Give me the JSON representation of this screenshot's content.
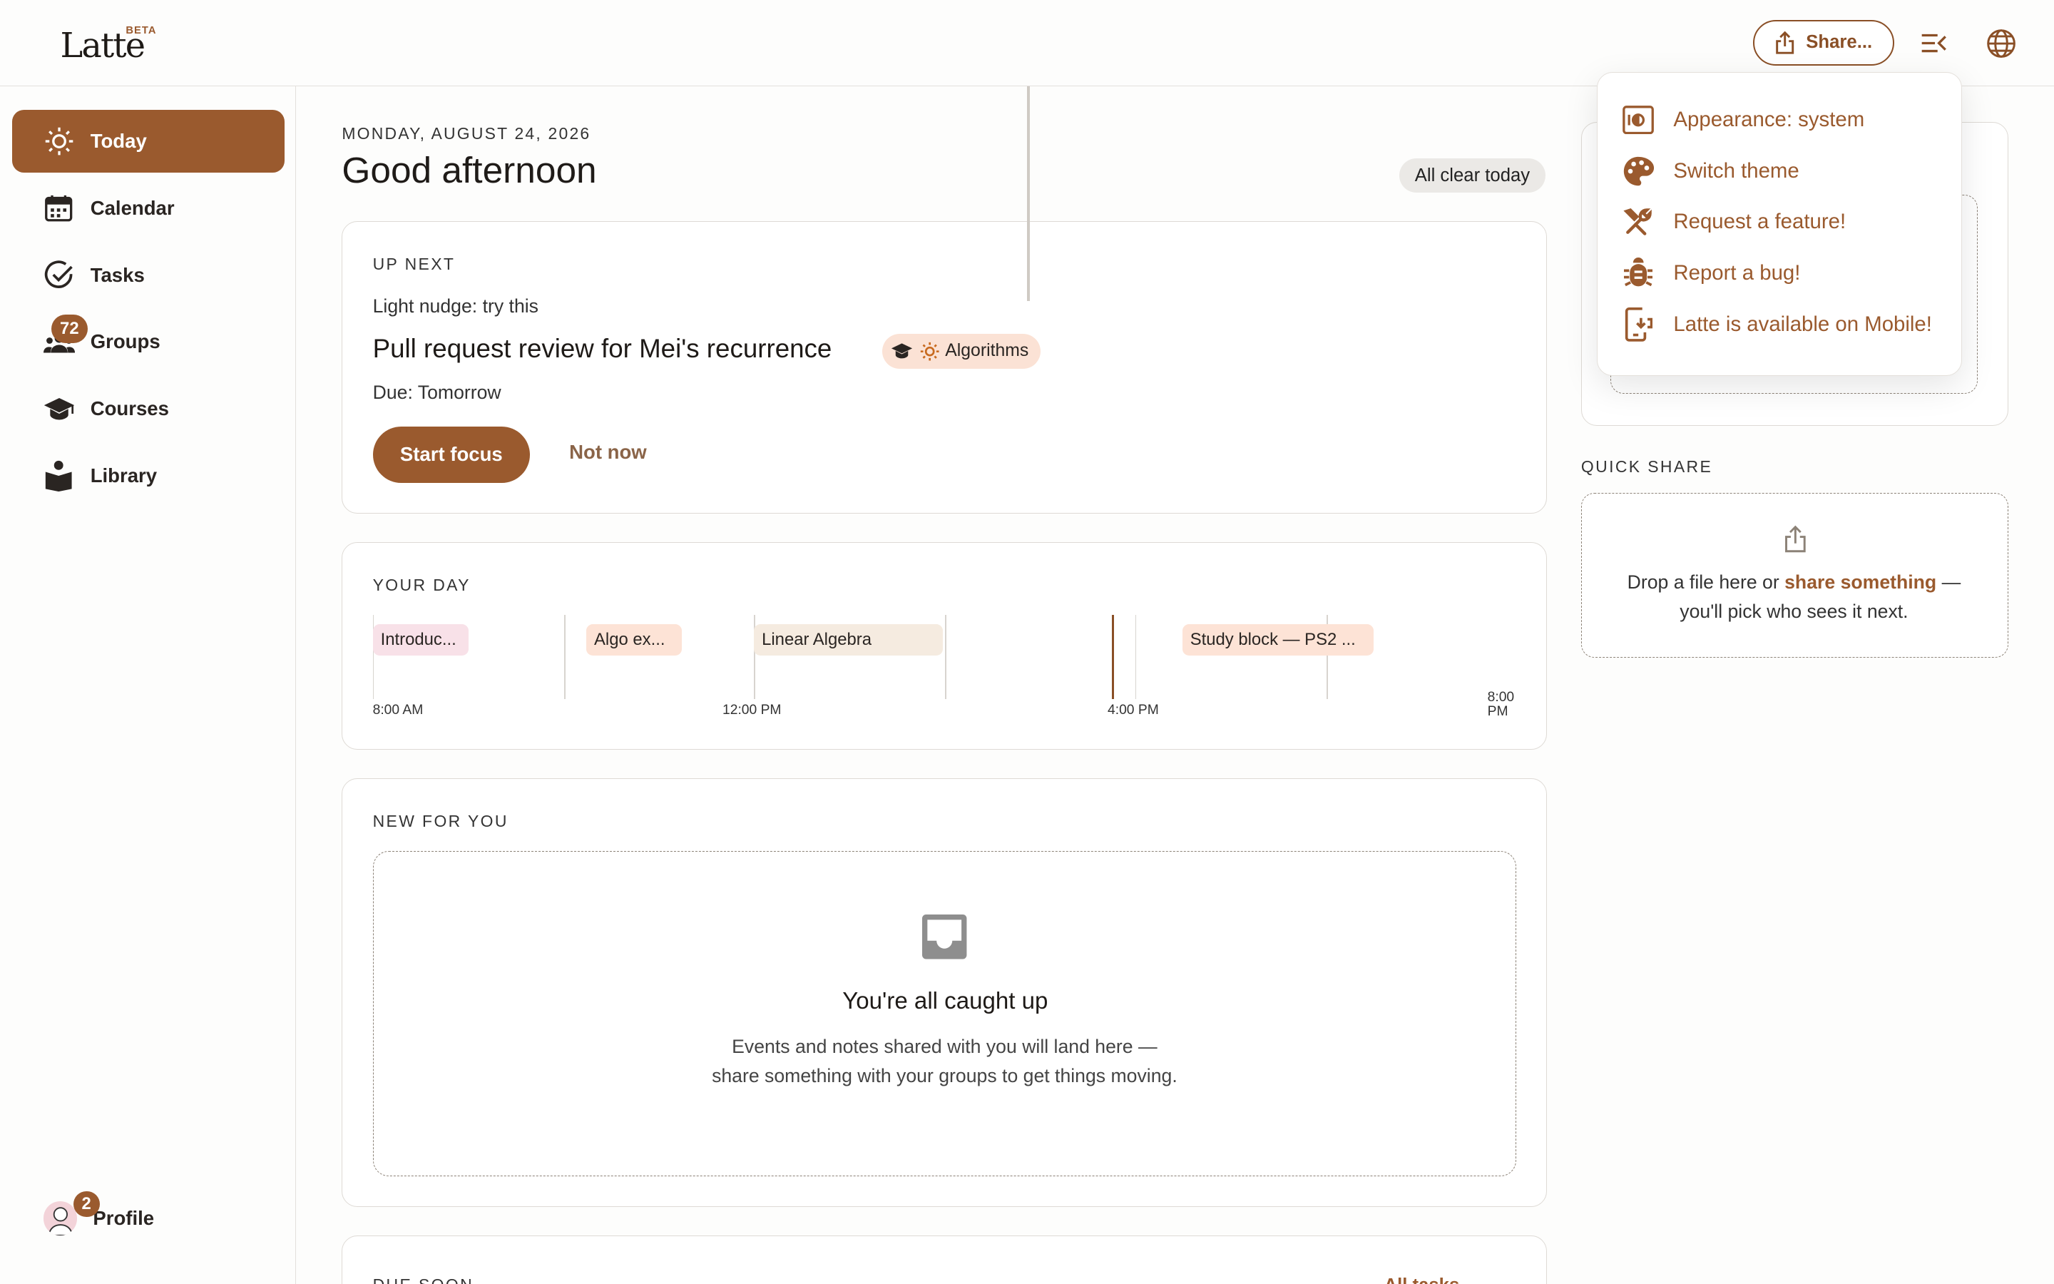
{
  "brand": {
    "name": "Latte",
    "beta": "BETA"
  },
  "topbar": {
    "share_label": "Share..."
  },
  "sidebar": {
    "items": [
      {
        "label": "Today",
        "icon": "sun-icon"
      },
      {
        "label": "Calendar",
        "icon": "calendar-icon"
      },
      {
        "label": "Tasks",
        "icon": "check-circle-icon"
      },
      {
        "label": "Groups",
        "icon": "group-icon",
        "badge": "72"
      },
      {
        "label": "Courses",
        "icon": "graduation-cap-icon"
      },
      {
        "label": "Library",
        "icon": "book-reader-icon"
      }
    ],
    "profile": {
      "label": "Profile",
      "badge": "2"
    }
  },
  "header": {
    "date": "MONDAY, AUGUST 24, 2026",
    "greeting": "Good afternoon",
    "status_pill": "All clear today"
  },
  "up_next": {
    "title": "UP NEXT",
    "nudge": "Light nudge: try this",
    "task": "Pull request review for Mei's recurrence",
    "course": "Algorithms",
    "due": "Due: Tomorrow",
    "primary": "Start focus",
    "secondary": "Not now"
  },
  "your_day": {
    "title": "YOUR DAY",
    "events": [
      "Introduc...",
      "Algo ex...",
      "Linear Algebra",
      "Study block — PS2 ..."
    ],
    "labels": [
      "8:00 AM",
      "12:00 PM",
      "4:00 PM",
      "8:00",
      "PM"
    ]
  },
  "new_for_you": {
    "title": "NEW FOR YOU",
    "empty_title": "You're all caught up",
    "empty_sub": "Events and notes shared with you will land here — share something with your groups to get things moving."
  },
  "due_soon": {
    "title": "DUE SOON",
    "link": "All tasks"
  },
  "quick_share": {
    "title": "QUICK SHARE",
    "text_before": "Drop a file here or ",
    "link": "share something",
    "text_after": " — you'll pick who sees it next."
  },
  "menu": {
    "items": [
      {
        "label": "Appearance: system",
        "icon": "appearance-icon"
      },
      {
        "label": "Switch theme",
        "icon": "palette-icon"
      },
      {
        "label": "Request a feature!",
        "icon": "tools-icon"
      },
      {
        "label": "Report a bug!",
        "icon": "bug-icon"
      },
      {
        "label": "Latte is available on Mobile!",
        "icon": "mobile-download-icon"
      }
    ]
  },
  "colors": {
    "accent": "#9a5a2e",
    "event_pink": "#f8e1e8",
    "event_peach": "#fde3d6",
    "event_beige": "#f5ebe0"
  }
}
